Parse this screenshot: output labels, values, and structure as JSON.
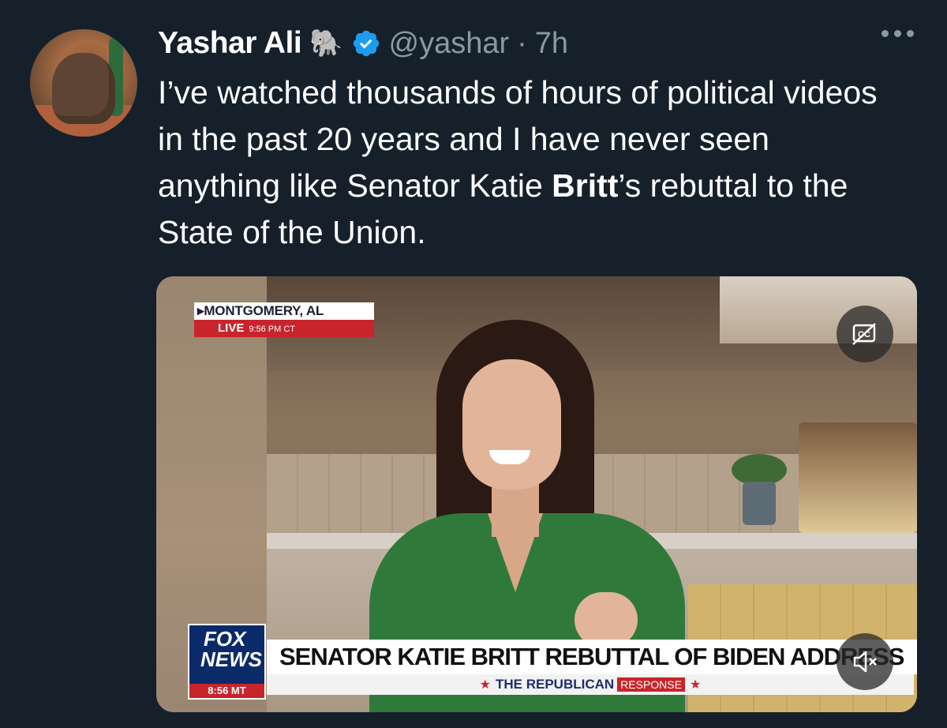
{
  "tweet": {
    "author_name": "Yashar Ali",
    "author_emoji": "🐘",
    "handle": "@yashar",
    "separator": "·",
    "time": "7h",
    "text_part1": "I’ve watched thousands of hours of political videos in the past 20 years and I have never seen anything like Senator Katie ",
    "text_bold": "Britt",
    "text_part2": "’s rebuttal to the State of the Union."
  },
  "video": {
    "location": "MONTGOMERY, AL",
    "live_label": "LIVE",
    "live_time": "9:56 PM CT",
    "network_line1": "FOX",
    "network_line2": "NEWS",
    "network_time": "8:56 MT",
    "chyron_headline": "SENATOR KATIE BRITT REBUTTAL OF BIDEN ADDRESS",
    "chyron_sub": "THE REPUBLICAN",
    "chyron_sub_tag": "RESPONSE"
  },
  "icons": {
    "verified": "verified-badge-icon",
    "more": "more-icon",
    "captions": "captions-icon",
    "mute": "mute-icon"
  },
  "colors": {
    "background": "#15202b",
    "secondary_text": "#8b98a5",
    "verified_blue": "#1d9bf0"
  }
}
